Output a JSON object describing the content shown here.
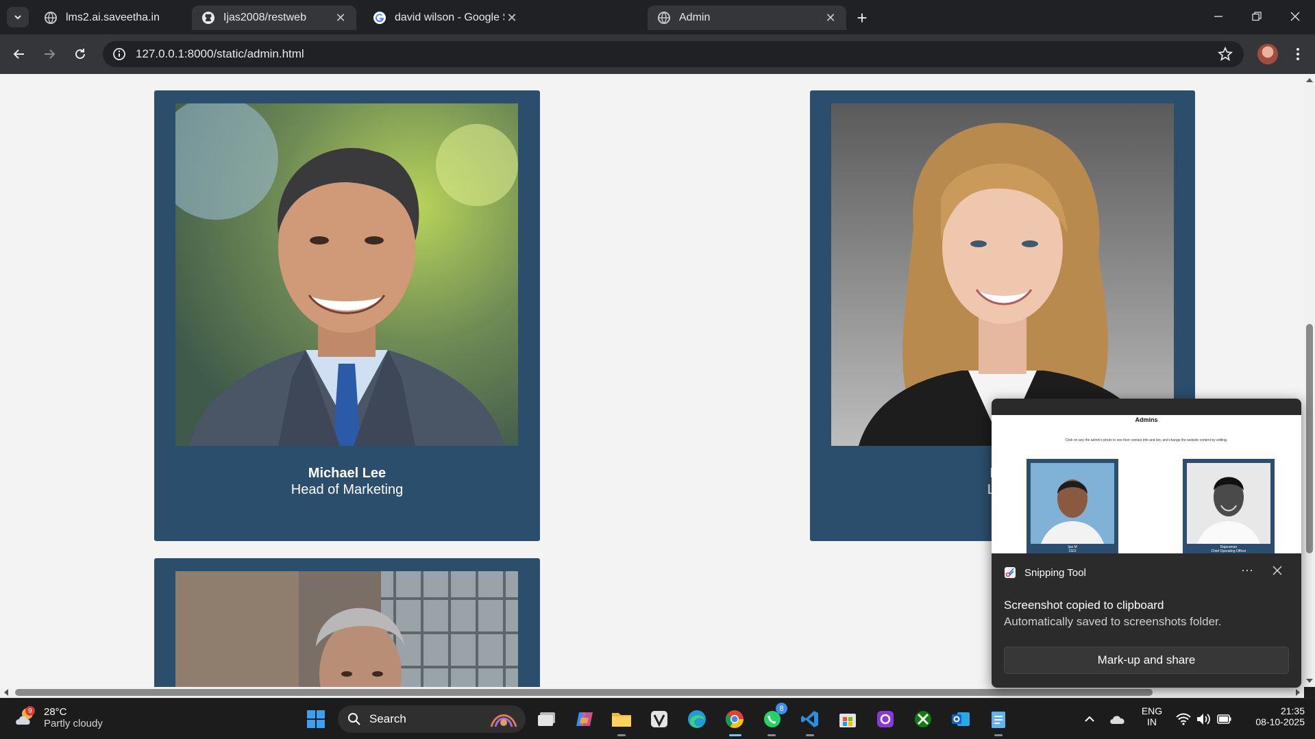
{
  "browser": {
    "tabs": [
      {
        "title": "lms2.ai.saveetha.in",
        "favicon": "globe-icon",
        "active": false
      },
      {
        "title": "Ijas2008/restweb",
        "favicon": "github-icon",
        "active": false
      },
      {
        "title": "david wilson - Google Search",
        "favicon": "google-icon",
        "active": false
      },
      {
        "title": "Admin",
        "favicon": "globe-icon",
        "active": true
      }
    ],
    "address": "127.0.0.1:8000/static/admin.html"
  },
  "page": {
    "cards": [
      {
        "name": "Michael Lee",
        "role": "Head of Marketing"
      },
      {
        "name": "Emi",
        "role": "Lead"
      }
    ]
  },
  "snipping_toast": {
    "app_name": "Snipping Tool",
    "more_label": "···",
    "title": "Screenshot copied to clipboard",
    "message": "Automatically saved to screenshots folder.",
    "action_label": "Mark-up and share",
    "preview": {
      "page_title": "Admins",
      "subtitle": "Click on any the admin's photo to see their contact info and bio, and change the website content by editing.",
      "cards": [
        {
          "name": "Ijas M",
          "role": "CEO"
        },
        {
          "name": "Rajaraman",
          "role": "Chief Operating Officer"
        }
      ]
    }
  },
  "taskbar": {
    "weather": {
      "temp": "28°C",
      "condition": "Partly cloudy",
      "badge": "9"
    },
    "search_label": "Search",
    "whatsapp_badge": "8",
    "language": "ENG",
    "region": "IN",
    "time": "21:35",
    "date": "08-10-2025"
  },
  "colors": {
    "card_bg": "#2a4e6c",
    "page_bg": "#f3f3f3",
    "chrome_dark": "#202124",
    "chrome_toolbar": "#35363a"
  }
}
